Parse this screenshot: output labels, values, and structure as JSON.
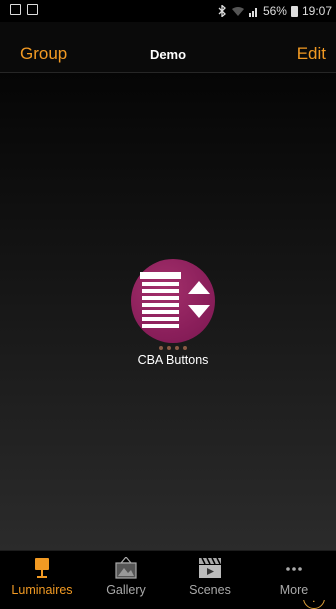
{
  "status_bar": {
    "battery": "56%",
    "time": "19:07",
    "icons": [
      "image-icon",
      "clipboard-icon",
      "bluetooth-icon",
      "wifi-icon",
      "signal-icon",
      "battery-icon"
    ]
  },
  "nav": {
    "left_label": "Group",
    "title": "Demo",
    "right_label": "Edit"
  },
  "groups": [
    {
      "label": "CBA Buttons",
      "icon": "blinds-up-down-icon",
      "color": "#8b1f5b"
    }
  ],
  "help": {
    "label": "?"
  },
  "tabs": [
    {
      "label": "Luminaires",
      "icon": "lamp-icon",
      "active": true
    },
    {
      "label": "Gallery",
      "icon": "gallery-icon",
      "active": false
    },
    {
      "label": "Scenes",
      "icon": "clapperboard-icon",
      "active": false
    },
    {
      "label": "More",
      "icon": "more-icon",
      "active": false
    }
  ],
  "colors": {
    "accent": "#f29a23",
    "inactive": "#a9a9a9",
    "group_circle": "#8b1f5b"
  }
}
